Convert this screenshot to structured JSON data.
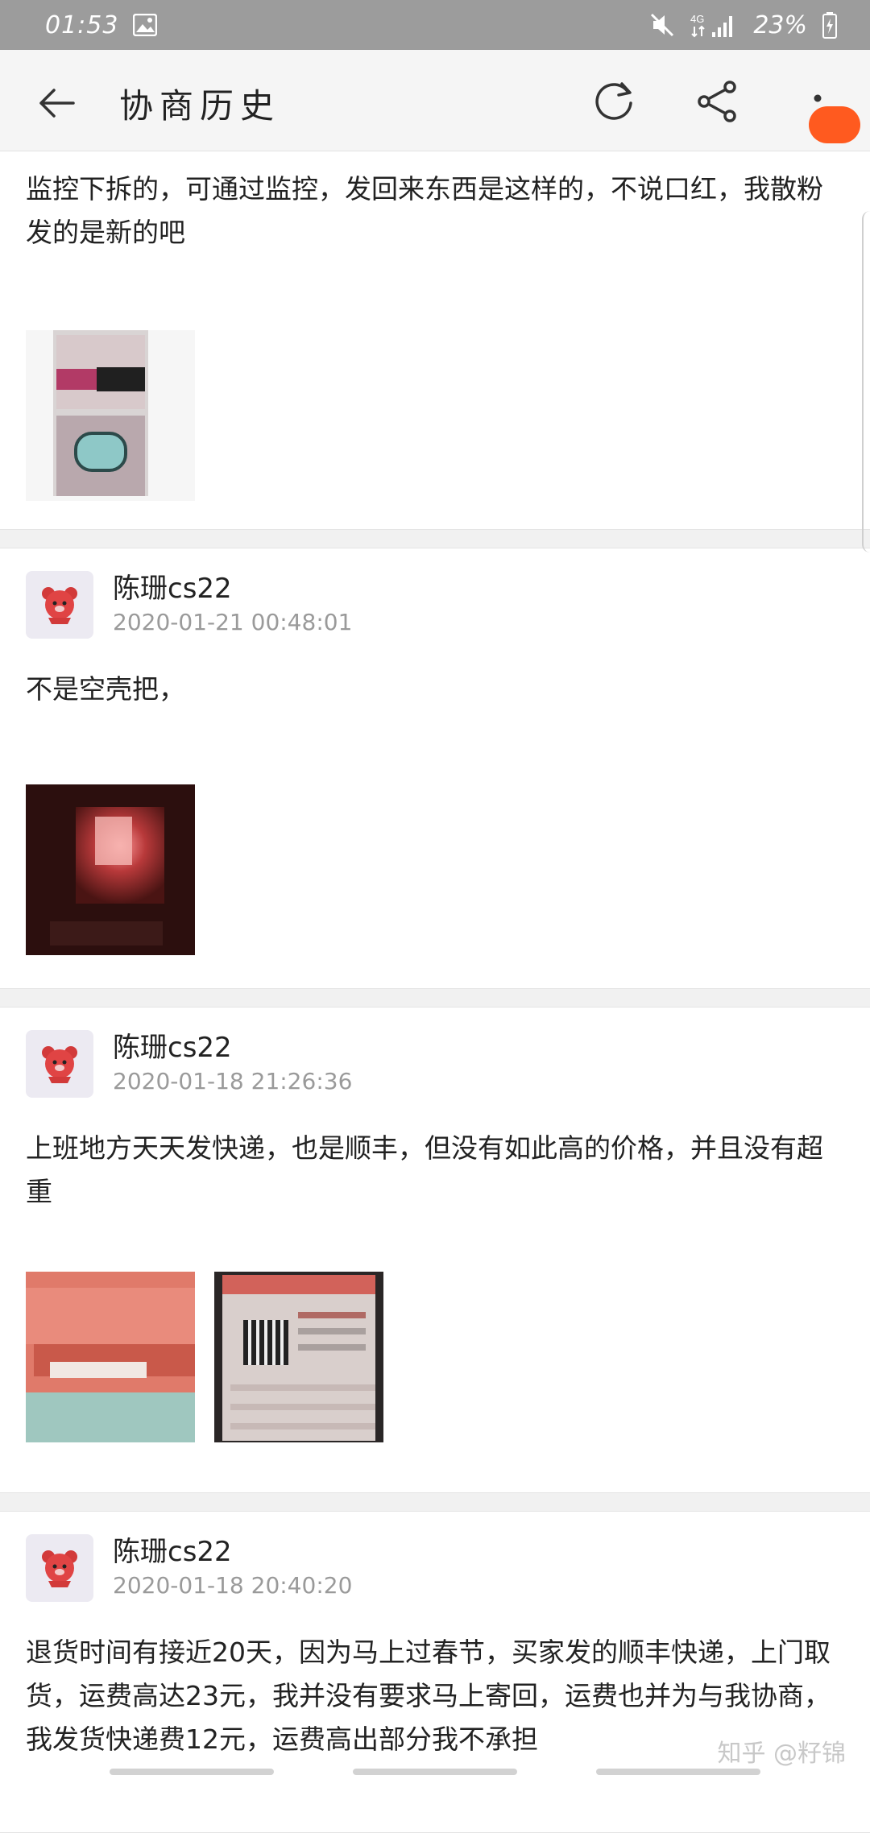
{
  "status_bar": {
    "time": "01:53",
    "network": "4G",
    "battery": "23%"
  },
  "app_bar": {
    "title": "协商历史",
    "icons": [
      "back-arrow-icon",
      "refresh-icon",
      "share-icon",
      "more-vertical-icon"
    ],
    "accent_color": "#ff5a1f"
  },
  "messages": [
    {
      "text": "监控下拆的，可通过监控，发回来东西是这样的，不说口红，我散粉发的是新的吧",
      "images": [
        "lipstick-powder-photo"
      ]
    },
    {
      "author": "陈珊cs22",
      "time": "2020-01-21 00:48:01",
      "text": "不是空壳把，",
      "images": [
        "dark-box-photo"
      ]
    },
    {
      "author": "陈珊cs22",
      "time": "2020-01-18 21:26:36",
      "text": "上班地方天天发快递，也是顺丰，但没有如此高的价格，并且没有超重",
      "images": [
        "express-bags-photo",
        "waybills-photo"
      ]
    },
    {
      "author": "陈珊cs22",
      "time": "2020-01-18 20:40:20",
      "text": "退货时间有接近20天，因为马上过春节，买家发的顺丰快递，上门取货，运费高达23元，我并没有要求马上寄回，运费也并为与我协商，我发货快递费12元，运费高出部分我不承担"
    }
  ],
  "watermark": "知乎 @籽锦"
}
